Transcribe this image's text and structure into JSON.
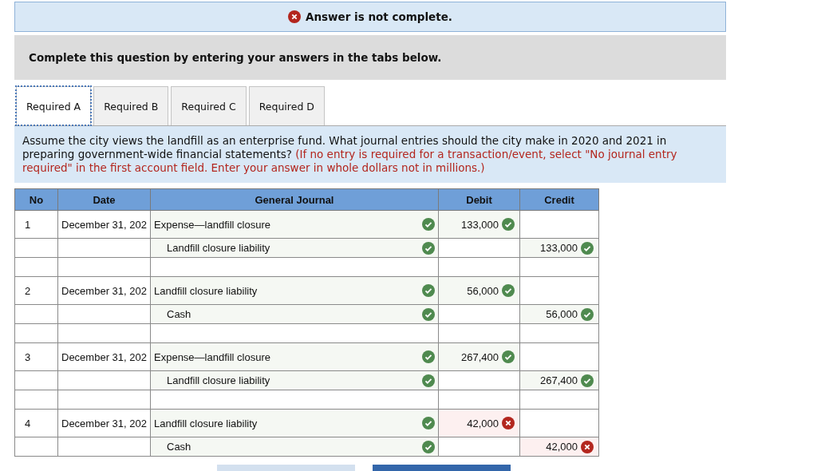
{
  "banner": {
    "complete": false,
    "text": "Answer is not complete."
  },
  "instructions": "Complete this question by entering your answers in the tabs below.",
  "tabs": [
    {
      "label": "Required A",
      "selected": true
    },
    {
      "label": "Required B",
      "selected": false
    },
    {
      "label": "Required C",
      "selected": false
    },
    {
      "label": "Required D",
      "selected": false
    }
  ],
  "question": {
    "text": "Assume the city views the landfill as an enterprise fund. What journal entries should the city make in 2020 and 2021 in preparing government-wide financial statements?",
    "note": "(If no entry is required for a transaction/event, select \"No journal entry required\" in the first account field. Enter your answer in whole dollars not in millions.)"
  },
  "table": {
    "columns": [
      "No",
      "Date",
      "General Journal",
      "Debit",
      "Credit"
    ],
    "rows": [
      {
        "kind": "debit",
        "no": "1",
        "date": "December 31, 202",
        "account": "Expense—landfill closure",
        "account_correct": true,
        "amount": "133,000",
        "amount_correct": true
      },
      {
        "kind": "credit",
        "account": "Landfill closure liability",
        "account_correct": true,
        "amount": "133,000",
        "amount_correct": true
      },
      {
        "kind": "blank"
      },
      {
        "kind": "debit",
        "no": "2",
        "date": "December 31, 202",
        "account": "Landfill closure liability",
        "account_correct": true,
        "amount": "56,000",
        "amount_correct": true
      },
      {
        "kind": "credit",
        "account": "Cash",
        "account_correct": true,
        "amount": "56,000",
        "amount_correct": true
      },
      {
        "kind": "blank"
      },
      {
        "kind": "debit",
        "no": "3",
        "date": "December 31, 202",
        "account": "Expense—landfill closure",
        "account_correct": true,
        "amount": "267,400",
        "amount_correct": true
      },
      {
        "kind": "credit",
        "account": "Landfill closure liability",
        "account_correct": true,
        "amount": "267,400",
        "amount_correct": true
      },
      {
        "kind": "blank"
      },
      {
        "kind": "debit",
        "no": "4",
        "date": "December 31, 202",
        "account": "Landfill closure liability",
        "account_correct": true,
        "amount": "42,000",
        "amount_correct": false
      },
      {
        "kind": "credit",
        "account": "Cash",
        "account_correct": true,
        "amount": "42,000",
        "amount_correct": false
      }
    ]
  },
  "nav_buttons": [
    {
      "kind": "secondary"
    },
    {
      "kind": "primary"
    }
  ]
}
